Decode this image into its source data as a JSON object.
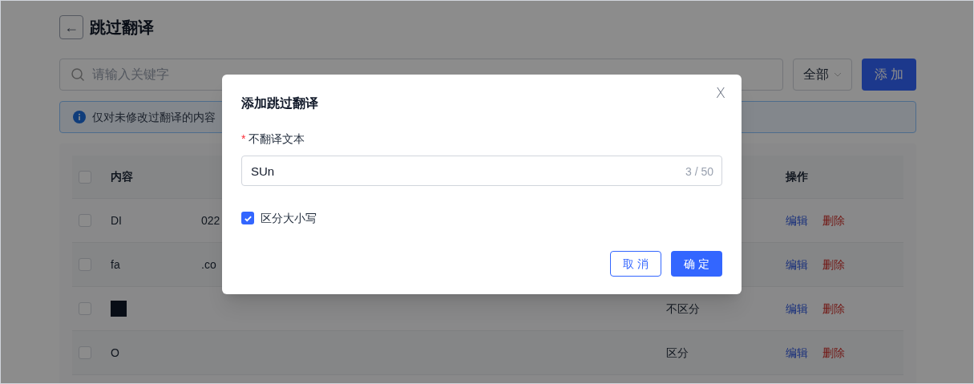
{
  "page": {
    "title": "跳过翻译",
    "back_icon": "←"
  },
  "toolbar": {
    "search_placeholder": "请输入关键字",
    "filter": "全部",
    "add_button": "添 加"
  },
  "notice": "仅对未修改过翻译的内容",
  "table": {
    "header_checked": false,
    "columns": [
      "内容",
      "操作"
    ],
    "rows": [
      {
        "checked": false,
        "content": [
          "DI",
          "022"
        ],
        "case": "",
        "actions": [
          "编辑",
          "删除"
        ]
      },
      {
        "checked": false,
        "content": [
          "fa",
          ".co"
        ],
        "case": "",
        "actions": [
          "编辑",
          "删除"
        ]
      },
      {
        "checked": false,
        "content": [],
        "redacted": true,
        "case": "不区分",
        "actions": [
          "编辑",
          "删除"
        ]
      },
      {
        "checked": false,
        "content": [
          "O"
        ],
        "case": "区分",
        "actions": [
          "编辑",
          "删除"
        ]
      }
    ]
  },
  "dialog": {
    "title": "添加跳过翻译",
    "close": "X",
    "field_label": "不翻译文本",
    "required_mark": "*",
    "value": "SUn",
    "counter": "3 / 50",
    "case_checkbox": {
      "label": "区分大小写",
      "checked": true
    },
    "buttons": [
      "取 消",
      "确 定"
    ]
  }
}
